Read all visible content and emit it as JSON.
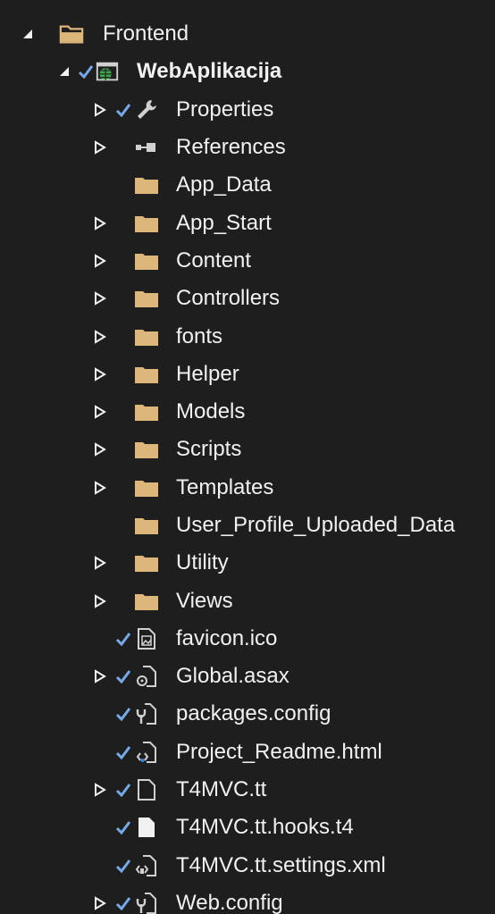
{
  "tree": {
    "root": {
      "label": "Frontend",
      "icon": "solution-folder-icon",
      "expanded": true
    },
    "project": {
      "label": "WebAplikacija",
      "icon": "web-project-icon",
      "expanded": true,
      "checked": true
    },
    "items": [
      {
        "label": "Properties",
        "icon": "wrench-icon",
        "expander": "collapsed",
        "checked": true
      },
      {
        "label": "References",
        "icon": "references-icon",
        "expander": "collapsed",
        "checked": false
      },
      {
        "label": "App_Data",
        "icon": "folder-icon",
        "expander": "none",
        "checked": false
      },
      {
        "label": "App_Start",
        "icon": "folder-icon",
        "expander": "collapsed",
        "checked": false
      },
      {
        "label": "Content",
        "icon": "folder-icon",
        "expander": "collapsed",
        "checked": false
      },
      {
        "label": "Controllers",
        "icon": "folder-icon",
        "expander": "collapsed",
        "checked": false
      },
      {
        "label": "fonts",
        "icon": "folder-icon",
        "expander": "collapsed",
        "checked": false
      },
      {
        "label": "Helper",
        "icon": "folder-icon",
        "expander": "collapsed",
        "checked": false
      },
      {
        "label": "Models",
        "icon": "folder-icon",
        "expander": "collapsed",
        "checked": false
      },
      {
        "label": "Scripts",
        "icon": "folder-icon",
        "expander": "collapsed",
        "checked": false
      },
      {
        "label": "Templates",
        "icon": "folder-icon",
        "expander": "collapsed",
        "checked": false
      },
      {
        "label": "User_Profile_Uploaded_Data",
        "icon": "folder-icon",
        "expander": "none",
        "checked": false
      },
      {
        "label": "Utility",
        "icon": "folder-icon",
        "expander": "collapsed",
        "checked": false
      },
      {
        "label": "Views",
        "icon": "folder-icon",
        "expander": "collapsed",
        "checked": false
      },
      {
        "label": "favicon.ico",
        "icon": "image-file-icon",
        "expander": "none",
        "checked": true
      },
      {
        "label": "Global.asax",
        "icon": "asax-file-icon",
        "expander": "collapsed",
        "checked": true
      },
      {
        "label": "packages.config",
        "icon": "config-file-icon",
        "expander": "none",
        "checked": true
      },
      {
        "label": "Project_Readme.html",
        "icon": "html-file-icon",
        "expander": "none",
        "checked": true
      },
      {
        "label": "T4MVC.tt",
        "icon": "file-icon",
        "expander": "collapsed",
        "checked": true
      },
      {
        "label": "T4MVC.tt.hooks.t4",
        "icon": "white-file-icon",
        "expander": "none",
        "checked": true
      },
      {
        "label": "T4MVC.tt.settings.xml",
        "icon": "xml-file-icon",
        "expander": "none",
        "checked": true
      },
      {
        "label": "Web.config",
        "icon": "config-file-icon",
        "expander": "collapsed",
        "checked": true
      }
    ]
  },
  "colors": {
    "background": "#1e1e1e",
    "text": "#f1f1f1",
    "folder": "#dcb67a",
    "check": "#75a9e8",
    "glyph": "#d0d0d0"
  }
}
